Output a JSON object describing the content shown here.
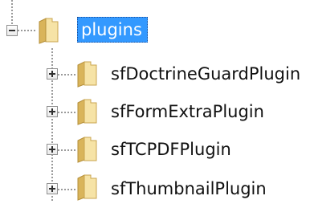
{
  "tree": {
    "root": {
      "label": "plugins",
      "expanded": true,
      "selected": true,
      "icon": "folder-open-icon"
    },
    "children": [
      {
        "label": "sfDoctrineGuardPlugin",
        "expanded": false,
        "icon": "folder-icon"
      },
      {
        "label": "sfFormExtraPlugin",
        "expanded": false,
        "icon": "folder-icon"
      },
      {
        "label": "sfTCPDFPlugin",
        "expanded": false,
        "icon": "folder-icon"
      },
      {
        "label": "sfThumbnailPlugin",
        "expanded": false,
        "icon": "folder-icon"
      }
    ]
  },
  "colors": {
    "selection": "#3399ff",
    "selection_text": "#ffffff",
    "folder_light": "#f6e3a6",
    "folder_dark": "#d9b45a",
    "connector": "#9a9a9a"
  }
}
